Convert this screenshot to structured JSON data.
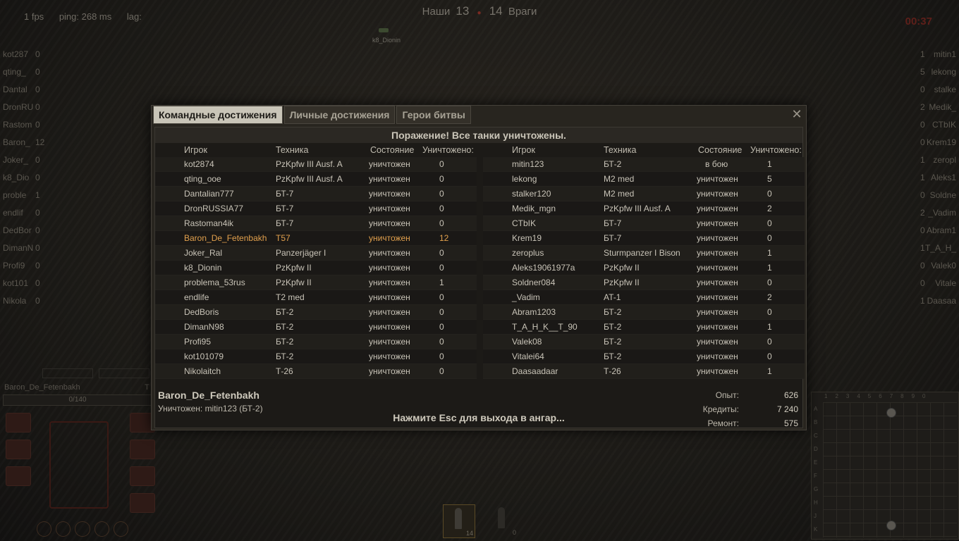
{
  "hud": {
    "fps": "1 fps",
    "ping": "ping: 268 ms",
    "lag": "lag:",
    "ally_label": "Наши",
    "ally_score": "13",
    "enemy_score": "14",
    "enemy_label": "Враги",
    "timer": "00:37",
    "map_marker": "k8_Dionin"
  },
  "left_list": [
    {
      "n": "kot287",
      "v": "0"
    },
    {
      "n": "qting_",
      "v": "0"
    },
    {
      "n": "Dantal",
      "v": "0"
    },
    {
      "n": "DronRU",
      "v": "0"
    },
    {
      "n": "Rastom",
      "v": "0"
    },
    {
      "n": "Baron_",
      "v": "12"
    },
    {
      "n": "Joker_",
      "v": "0"
    },
    {
      "n": "k8_Dio",
      "v": "0"
    },
    {
      "n": "proble",
      "v": "1"
    },
    {
      "n": "endlif",
      "v": "0"
    },
    {
      "n": "DedBor",
      "v": "0"
    },
    {
      "n": "DimanN",
      "v": "0"
    },
    {
      "n": "Profi9",
      "v": "0"
    },
    {
      "n": "kot101",
      "v": "0"
    },
    {
      "n": "Nikola",
      "v": "0"
    }
  ],
  "right_list": [
    {
      "n": "mitin1",
      "v": "1"
    },
    {
      "n": "lekong",
      "v": "5"
    },
    {
      "n": "stalke",
      "v": "0"
    },
    {
      "n": "Medik_",
      "v": "2"
    },
    {
      "n": "CTbIK",
      "v": "0"
    },
    {
      "n": "Krem19",
      "v": "0"
    },
    {
      "n": "zeropl",
      "v": "1"
    },
    {
      "n": "Aleks1",
      "v": "1"
    },
    {
      "n": "Soldne",
      "v": "0"
    },
    {
      "n": "_Vadim",
      "v": "2"
    },
    {
      "n": "Abram1",
      "v": "0"
    },
    {
      "n": "T_A_H_",
      "v": "1"
    },
    {
      "n": "Valek0",
      "v": "0"
    },
    {
      "n": "Vitale",
      "v": "0"
    },
    {
      "n": "Daasaa",
      "v": "1"
    }
  ],
  "player_panel": {
    "name": "Baron_De_Fetenbakh",
    "tag": "T",
    "hp": "0/140"
  },
  "ammo": {
    "slot1_count": "14",
    "slot2_count": "0"
  },
  "minimap": {
    "letters": [
      "A",
      "B",
      "C",
      "D",
      "E",
      "F",
      "G",
      "H",
      "J",
      "K"
    ],
    "numbers": "1234567890"
  },
  "dialog": {
    "tabs": [
      "Командные достижения",
      "Личные достижения",
      "Герои битвы"
    ],
    "close": "✕",
    "banner": "Поражение! Все танки уничтожены.",
    "headers": {
      "player": "Игрок",
      "vehicle": "Техника",
      "state": "Состояние",
      "kills": "Уничтожено:"
    },
    "ally_team": [
      {
        "player": "kot2874",
        "vehicle": "PzKpfw III Ausf. A",
        "state": "уничтожен",
        "kills": "0"
      },
      {
        "player": "qting_ooe",
        "vehicle": "PzKpfw III Ausf. A",
        "state": "уничтожен",
        "kills": "0"
      },
      {
        "player": "Dantalian777",
        "vehicle": "БТ-7",
        "state": "уничтожен",
        "kills": "0"
      },
      {
        "player": "DronRUSSIA77",
        "vehicle": "БТ-7",
        "state": "уничтожен",
        "kills": "0"
      },
      {
        "player": "Rastoman4ik",
        "vehicle": "БТ-7",
        "state": "уничтожен",
        "kills": "0"
      },
      {
        "player": "Baron_De_Fetenbakh",
        "vehicle": "T57",
        "state": "уничтожен",
        "kills": "12",
        "me": true
      },
      {
        "player": "Joker_Ral",
        "vehicle": "Panzerjäger I",
        "state": "уничтожен",
        "kills": "0"
      },
      {
        "player": "k8_Dionin",
        "vehicle": "PzKpfw II",
        "state": "уничтожен",
        "kills": "0"
      },
      {
        "player": "problema_53rus",
        "vehicle": "PzKpfw II",
        "state": "уничтожен",
        "kills": "1"
      },
      {
        "player": "endlife",
        "vehicle": "T2 med",
        "state": "уничтожен",
        "kills": "0"
      },
      {
        "player": "DedBoris",
        "vehicle": "БТ-2",
        "state": "уничтожен",
        "kills": "0"
      },
      {
        "player": "DimanN98",
        "vehicle": "БТ-2",
        "state": "уничтожен",
        "kills": "0"
      },
      {
        "player": "Profi95",
        "vehicle": "БТ-2",
        "state": "уничтожен",
        "kills": "0"
      },
      {
        "player": "kot101079",
        "vehicle": "БТ-2",
        "state": "уничтожен",
        "kills": "0"
      },
      {
        "player": "Nikolaitch",
        "vehicle": "Т-26",
        "state": "уничтожен",
        "kills": "0"
      }
    ],
    "enemy_team": [
      {
        "player": "mitin123",
        "vehicle": "БТ-2",
        "state": "в бою",
        "kills": "1",
        "alive": true
      },
      {
        "player": "lekong",
        "vehicle": "M2 med",
        "state": "уничтожен",
        "kills": "5"
      },
      {
        "player": "stalker120",
        "vehicle": "M2 med",
        "state": "уничтожен",
        "kills": "0"
      },
      {
        "player": "Medik_mgn",
        "vehicle": "PzKpfw III Ausf. A",
        "state": "уничтожен",
        "kills": "2"
      },
      {
        "player": "CTbIK",
        "vehicle": "БТ-7",
        "state": "уничтожен",
        "kills": "0"
      },
      {
        "player": "Krem19",
        "vehicle": "БТ-7",
        "state": "уничтожен",
        "kills": "0"
      },
      {
        "player": "zeroplus",
        "vehicle": "Sturmpanzer I Bison",
        "state": "уничтожен",
        "kills": "1"
      },
      {
        "player": "Aleks19061977a",
        "vehicle": "PzKpfw II",
        "state": "уничтожен",
        "kills": "1"
      },
      {
        "player": "Soldner084",
        "vehicle": "PzKpfw II",
        "state": "уничтожен",
        "kills": "0"
      },
      {
        "player": "_Vadim",
        "vehicle": "AT-1",
        "state": "уничтожен",
        "kills": "2"
      },
      {
        "player": "Abram1203",
        "vehicle": "БТ-2",
        "state": "уничтожен",
        "kills": "0"
      },
      {
        "player": "T_A_H_K__T_90",
        "vehicle": "БТ-2",
        "state": "уничтожен",
        "kills": "1"
      },
      {
        "player": "Valek08",
        "vehicle": "БТ-2",
        "state": "уничтожен",
        "kills": "0"
      },
      {
        "player": "Vitalei64",
        "vehicle": "БТ-2",
        "state": "уничтожен",
        "kills": "0"
      },
      {
        "player": "Daasaadaar",
        "vehicle": "Т-26",
        "state": "уничтожен",
        "kills": "1"
      }
    ],
    "footer": {
      "name": "Baron_De_Fetenbakh",
      "killed_by": "Уничтожен: mitin123 (БТ-2)",
      "esc_hint": "Нажмите Esc для выхода в ангар...",
      "stats": [
        {
          "label": "Опыт:",
          "value": "626"
        },
        {
          "label": "Кредиты:",
          "value": "7 240"
        },
        {
          "label": "Ремонт:",
          "value": "575"
        }
      ]
    }
  },
  "colors": {
    "highlight": "#e1a04d",
    "timer": "#5e1f1a",
    "active_tab": "#c9c5b8"
  }
}
